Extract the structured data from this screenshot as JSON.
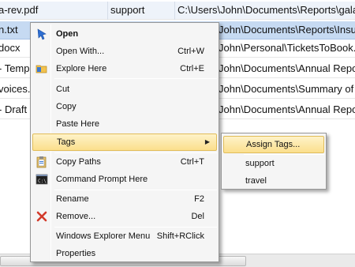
{
  "file_list": {
    "rows": [
      {
        "name": "a-rev.pdf",
        "tag": "support",
        "path": "C:\\Users\\John\\Documents\\Reports\\gala"
      },
      {
        "name": "n.txt",
        "tag": "",
        "path": "John\\Documents\\Reports\\Insu"
      },
      {
        "name": "docx",
        "tag": "",
        "path": "John\\Personal\\TicketsToBook."
      },
      {
        "name": "- Temp",
        "tag": "",
        "path": "John\\Documents\\Annual Repo"
      },
      {
        "name": "voices.",
        "tag": "",
        "path": "John\\Documents\\Summary of"
      },
      {
        "name": "- Draft",
        "tag": "",
        "path": "John\\Documents\\Annual Repo"
      }
    ]
  },
  "context_menu": {
    "open": "Open",
    "open_with": "Open With...",
    "open_with_shortcut": "Ctrl+W",
    "explore_here": "Explore Here",
    "explore_here_shortcut": "Ctrl+E",
    "cut": "Cut",
    "copy": "Copy",
    "paste_here": "Paste Here",
    "tags": "Tags",
    "copy_paths": "Copy Paths",
    "copy_paths_shortcut": "Ctrl+T",
    "command_prompt_here": "Command Prompt Here",
    "rename": "Rename",
    "rename_shortcut": "F2",
    "remove": "Remove...",
    "remove_shortcut": "Del",
    "windows_explorer_menu": "Windows Explorer Menu",
    "windows_explorer_menu_shortcut": "Shift+RClick",
    "properties": "Properties",
    "icons": {
      "open": "open-arrow-icon",
      "explore_here": "folder-icon",
      "tags": "tag-icon",
      "copy_paths": "clipboard-icon",
      "command_prompt_here": "command-prompt-icon",
      "remove": "red-x-icon"
    }
  },
  "tags_submenu": {
    "assign_tags": "Assign Tags...",
    "tags": [
      "support",
      "travel"
    ]
  },
  "colors": {
    "selection": "#c6daf2",
    "menu_highlight": "#fbdf8c",
    "menu_background": "#f5f5f5"
  }
}
